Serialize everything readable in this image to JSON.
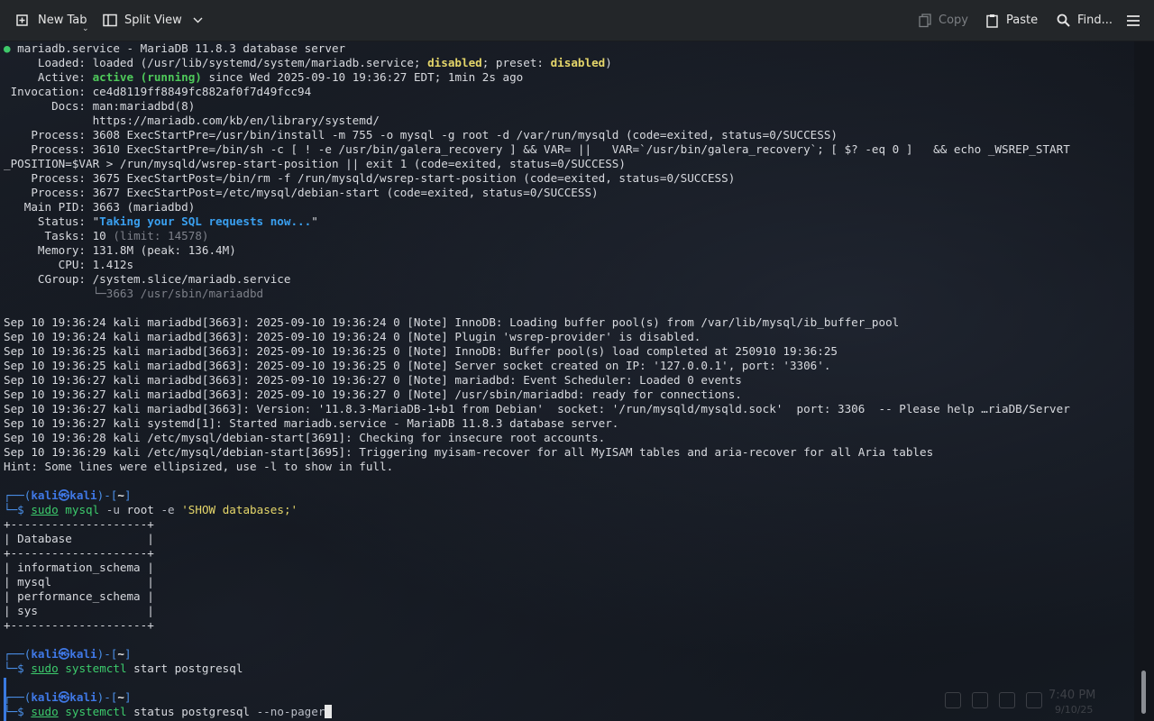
{
  "toolbar": {
    "new_tab": "New Tab",
    "split_view": "Split View",
    "copy": "Copy",
    "paste": "Paste",
    "find": "Find..."
  },
  "status": {
    "unit": " mariadb.service - MariaDB 11.8.3 database server",
    "loaded_a": "     Loaded: loaded (/usr/lib/systemd/system/mariadb.service; ",
    "loaded_disabled": "disabled",
    "loaded_b": "; preset: ",
    "loaded_preset": "disabled",
    "loaded_c": ")",
    "active_a": "     Active: ",
    "active_state": "active (running)",
    "active_b": " since Wed 2025-09-10 19:36:27 EDT; 1min 2s ago",
    "invocation": " Invocation: ce4d8119ff8849fc882af0f7d49fcc94",
    "docs1": "       Docs: man:mariadbd(8)",
    "docs2": "             https://mariadb.com/kb/en/library/systemd/",
    "proc1": "    Process: 3608 ExecStartPre=/usr/bin/install -m 755 -o mysql -g root -d /var/run/mysqld (code=exited, status=0/SUCCESS)",
    "proc2a": "    Process: 3610 ExecStartPre=/bin/sh -c [ ! -e /usr/bin/galera_recovery ] && VAR= ||   VAR=`/usr/bin/galera_recovery`; [ $? -eq 0 ]   && echo _WSREP_START",
    "proc2b": "_POSITION=$VAR > /run/mysqld/wsrep-start-position || exit 1 (code=exited, status=0/SUCCESS)",
    "proc3": "    Process: 3675 ExecStartPost=/bin/rm -f /run/mysqld/wsrep-start-position (code=exited, status=0/SUCCESS)",
    "proc4": "    Process: 3677 ExecStartPost=/etc/mysql/debian-start (code=exited, status=0/SUCCESS)",
    "mainpid": "   Main PID: 3663 (mariadbd)",
    "status_a": "     Status: \"",
    "status_msg": "Taking your SQL requests now...",
    "status_b": "\"",
    "tasks_a": "      Tasks: 10 ",
    "tasks_limit": "(limit: 14578)",
    "memory": "     Memory: 131.8M (peak: 136.4M)",
    "cpu": "        CPU: 1.412s",
    "cgroup": "     CGroup: /system.slice/mariadb.service",
    "cgroup_child": "             └─3663 /usr/sbin/mariadbd"
  },
  "log": [
    "Sep 10 19:36:24 kali mariadbd[3663]: 2025-09-10 19:36:24 0 [Note] InnoDB: Loading buffer pool(s) from /var/lib/mysql/ib_buffer_pool",
    "Sep 10 19:36:24 kali mariadbd[3663]: 2025-09-10 19:36:24 0 [Note] Plugin 'wsrep-provider' is disabled.",
    "Sep 10 19:36:25 kali mariadbd[3663]: 2025-09-10 19:36:25 0 [Note] InnoDB: Buffer pool(s) load completed at 250910 19:36:25",
    "Sep 10 19:36:25 kali mariadbd[3663]: 2025-09-10 19:36:25 0 [Note] Server socket created on IP: '127.0.0.1', port: '3306'.",
    "Sep 10 19:36:27 kali mariadbd[3663]: 2025-09-10 19:36:27 0 [Note] mariadbd: Event Scheduler: Loaded 0 events",
    "Sep 10 19:36:27 kali mariadbd[3663]: 2025-09-10 19:36:27 0 [Note] /usr/sbin/mariadbd: ready for connections.",
    "Sep 10 19:36:27 kali mariadbd[3663]: Version: '11.8.3-MariaDB-1+b1 from Debian'  socket: '/run/mysqld/mysqld.sock'  port: 3306  -- Please help …riaDB/Server",
    "Sep 10 19:36:27 kali systemd[1]: Started mariadb.service - MariaDB 11.8.3 database server.",
    "Sep 10 19:36:28 kali /etc/mysql/debian-start[3691]: Checking for insecure root accounts.",
    "Sep 10 19:36:29 kali /etc/mysql/debian-start[3695]: Triggering myisam-recover for all MyISAM tables and aria-recover for all Aria tables",
    "Hint: Some lines were ellipsized, use -l to show in full."
  ],
  "prompt": {
    "top_a": "┌──(",
    "user": "kali㉿kali",
    "top_b": ")-[",
    "dir": "~",
    "top_c": "]",
    "bottom": "└─$ "
  },
  "cmd1": {
    "sudo": "sudo",
    "prog": "mysql",
    "opt1": " -u",
    "arg1": " root",
    "opt2": " -e",
    "str": " 'SHOW databases;'"
  },
  "table": [
    "+--------------------+",
    "| Database           |",
    "+--------------------+",
    "| information_schema |",
    "| mysql              |",
    "| performance_schema |",
    "| sys                |",
    "+--------------------+"
  ],
  "cmd2": {
    "sudo": "sudo",
    "prog": "systemctl",
    "rest": " start postgresql"
  },
  "cmd3": {
    "sudo": "sudo",
    "prog": "systemctl",
    "rest": " status postgresql",
    "opt": " --no-pager"
  },
  "taskbar": {
    "clock": "7:40 PM",
    "date": "9/10/25"
  },
  "colors": {
    "accent": "#3a7ae0",
    "green": "#3ccb6c",
    "yellow": "#e5d66a",
    "status_blue": "#3aa0f0"
  }
}
